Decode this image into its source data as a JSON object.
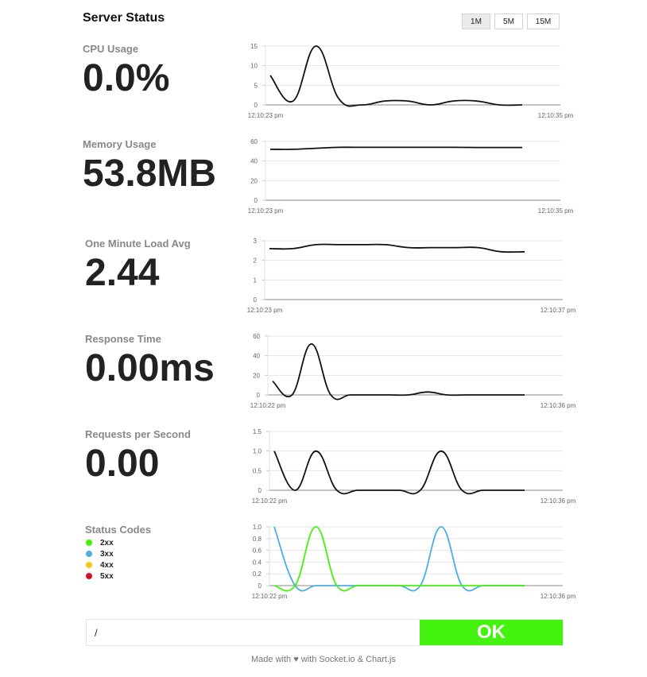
{
  "header": {
    "title": "Server Status"
  },
  "span_buttons": [
    {
      "label": "1M",
      "active": true
    },
    {
      "label": "5M",
      "active": false
    },
    {
      "label": "15M",
      "active": false
    }
  ],
  "metrics": {
    "cpu": {
      "label": "CPU Usage",
      "value": "0.0%"
    },
    "memory": {
      "label": "Memory Usage",
      "value": "53.8MB"
    },
    "load": {
      "label": "One Minute Load Avg",
      "value": "2.44"
    },
    "response": {
      "label": "Response Time",
      "value": "0.00ms"
    },
    "rps": {
      "label": "Requests per Second",
      "value": "0.00"
    },
    "status_codes": {
      "label": "Status Codes"
    }
  },
  "legend": [
    {
      "label": "2xx",
      "color": "#44f20f"
    },
    {
      "label": "3xx",
      "color": "#4aaee0"
    },
    {
      "label": "4xx",
      "color": "#f5c518"
    },
    {
      "label": "5xx",
      "color": "#d0112b"
    }
  ],
  "route": {
    "path": "/",
    "status": "OK",
    "status_color": "#44f20f"
  },
  "footer": {
    "text": "Made with ♥ with Socket.io & Chart.js"
  },
  "chart_data": [
    {
      "id": "cpu",
      "type": "line",
      "ylim": [
        0,
        15
      ],
      "yticks": [
        "0",
        "5",
        "10",
        "15"
      ],
      "yvals": [
        0,
        5,
        10,
        15
      ],
      "x_start_label": "12:10:23 pm",
      "x_end_label": "12:10:35 pm",
      "series": [
        {
          "color": "#111111",
          "values": [
            7.5,
            1,
            15,
            1.5,
            0,
            1,
            1,
            0,
            1,
            1,
            0,
            0
          ]
        }
      ]
    },
    {
      "id": "memory",
      "type": "line",
      "ylim": [
        0,
        60
      ],
      "yticks": [
        "0",
        "20",
        "40",
        "60"
      ],
      "yvals": [
        0,
        20,
        40,
        60
      ],
      "x_start_label": "12:10:23 pm",
      "x_end_label": "12:10:35 pm",
      "series": [
        {
          "color": "#111111",
          "values": [
            52,
            52,
            53,
            54,
            54,
            54,
            54,
            54,
            54,
            53.8,
            53.8,
            53.8
          ]
        }
      ]
    },
    {
      "id": "load",
      "type": "line",
      "ylim": [
        0,
        3
      ],
      "yticks": [
        "0",
        "1",
        "2",
        "3"
      ],
      "yvals": [
        0,
        1,
        2,
        3
      ],
      "x_start_label": "12:10:23 pm",
      "x_end_label": "12:10:37 pm",
      "series": [
        {
          "color": "#111111",
          "values": [
            2.6,
            2.6,
            2.8,
            2.8,
            2.8,
            2.8,
            2.65,
            2.65,
            2.65,
            2.65,
            2.44,
            2.44
          ]
        }
      ]
    },
    {
      "id": "response",
      "type": "line",
      "ylim": [
        0,
        60
      ],
      "yticks": [
        "0",
        "20",
        "40",
        "60"
      ],
      "yvals": [
        0,
        20,
        40,
        60
      ],
      "x_start_label": "12:10:22 pm",
      "x_end_label": "12:10:36 pm",
      "series": [
        {
          "color": "#111111",
          "values": [
            14,
            0,
            52,
            0,
            0,
            0,
            0,
            0,
            3,
            0,
            0,
            0,
            0,
            0
          ]
        }
      ]
    },
    {
      "id": "rps",
      "type": "line",
      "ylim": [
        0,
        1.5
      ],
      "yticks": [
        "0",
        "0.5",
        "1.0",
        "1.5"
      ],
      "yvals": [
        0,
        0.5,
        1.0,
        1.5
      ],
      "x_start_label": "12:10:22 pm",
      "x_end_label": "12:10:36 pm",
      "series": [
        {
          "color": "#111111",
          "values": [
            1,
            0,
            1,
            0,
            0,
            0,
            0,
            0,
            1,
            0,
            0,
            0,
            0
          ]
        }
      ]
    },
    {
      "id": "status",
      "type": "line",
      "ylim": [
        0,
        1
      ],
      "yticks": [
        "0",
        "0.2",
        "0.4",
        "0.6",
        "0.8",
        "1.0"
      ],
      "yvals": [
        0,
        0.2,
        0.4,
        0.6,
        0.8,
        1.0
      ],
      "x_start_label": "12:10:22 pm",
      "x_end_label": "12:10:36 pm",
      "series": [
        {
          "name": "3xx",
          "color": "#4aaee0",
          "values": [
            1,
            0,
            0,
            0,
            0,
            0,
            0,
            0,
            1,
            0,
            0,
            0,
            0
          ]
        },
        {
          "name": "2xx",
          "color": "#44f20f",
          "values": [
            0,
            0,
            1,
            0,
            0,
            0,
            0,
            0,
            0,
            0,
            0,
            0,
            0
          ]
        }
      ]
    }
  ]
}
